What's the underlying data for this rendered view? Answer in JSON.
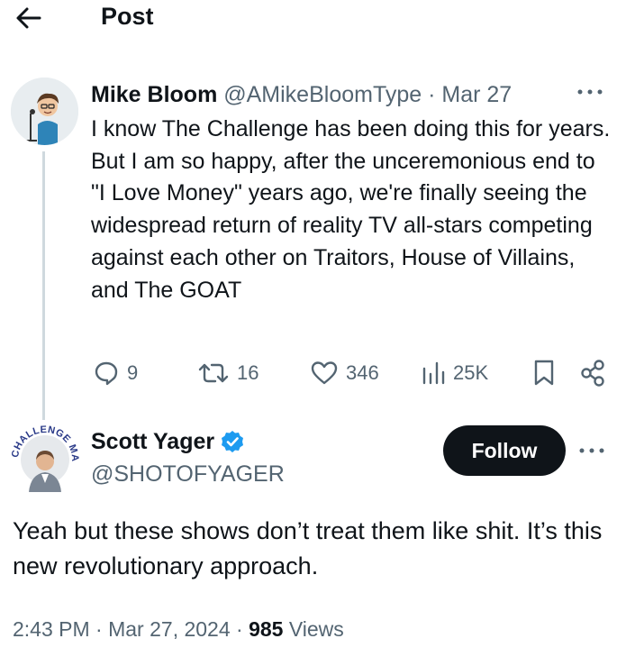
{
  "header": {
    "back_icon": "arrow-left-icon",
    "title": "Post"
  },
  "parent_tweet": {
    "display_name": "Mike Bloom",
    "handle": "@AMikeBloomType",
    "separator": "·",
    "date": "Mar 27",
    "more_icon": "more-horizontal-icon",
    "text": "I know The Challenge has been doing this for years. But I am so happy, after the unceremonious end to \"I Love Money\" years ago, we're finally seeing the widespread return of reality TV all-stars competing against each other on Traitors, House of Villains, and The GOAT",
    "actions": {
      "replies": "9",
      "reposts": "16",
      "likes": "346",
      "views": "25K"
    }
  },
  "reply_tweet": {
    "display_name": "Scott Yager",
    "verified": true,
    "verified_color": "#1d9bf0",
    "handle": "@SHOTOFYAGER",
    "follow_label": "Follow",
    "avatar_ring_text": "CHALLENGE MANIA",
    "text": "Yeah but these shows don’t treat them like shit. It’s this new revolutionary approach.",
    "time": "2:43 PM",
    "separator": "·",
    "date": "Mar 27, 2024",
    "views_count": "985",
    "views_label": "Views"
  },
  "colors": {
    "text_primary": "#0f1419",
    "text_muted": "#536471",
    "thread_line": "#cfd9de",
    "follow_bg": "#0f1419"
  }
}
